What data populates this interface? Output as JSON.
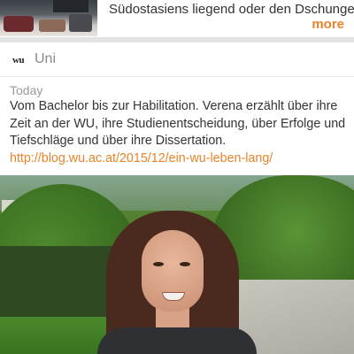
{
  "previous_post": {
    "thumbnail_icon": "photo-thumbnail",
    "text": "Südostasiens liegend oder den Dschungel",
    "more_label": "more"
  },
  "post": {
    "source_logo": "wu",
    "source_name": "Uni",
    "date": "Today",
    "body": "Vom Bachelor bis zur Habilitation. Verena erzählt über ihre Zeit an der WU, ihre Studienentscheidung, über Erfolge und Tiefschläge und über ihre Dissertation.",
    "link": "http://blog.wu.ac.at/2015/12/ein-wu-leben-lang/",
    "image_icon": "portrait-photo"
  },
  "colors": {
    "accent": "#e8842a",
    "divider": "#e3e3e3",
    "meta_text": "#9a9a9a"
  }
}
